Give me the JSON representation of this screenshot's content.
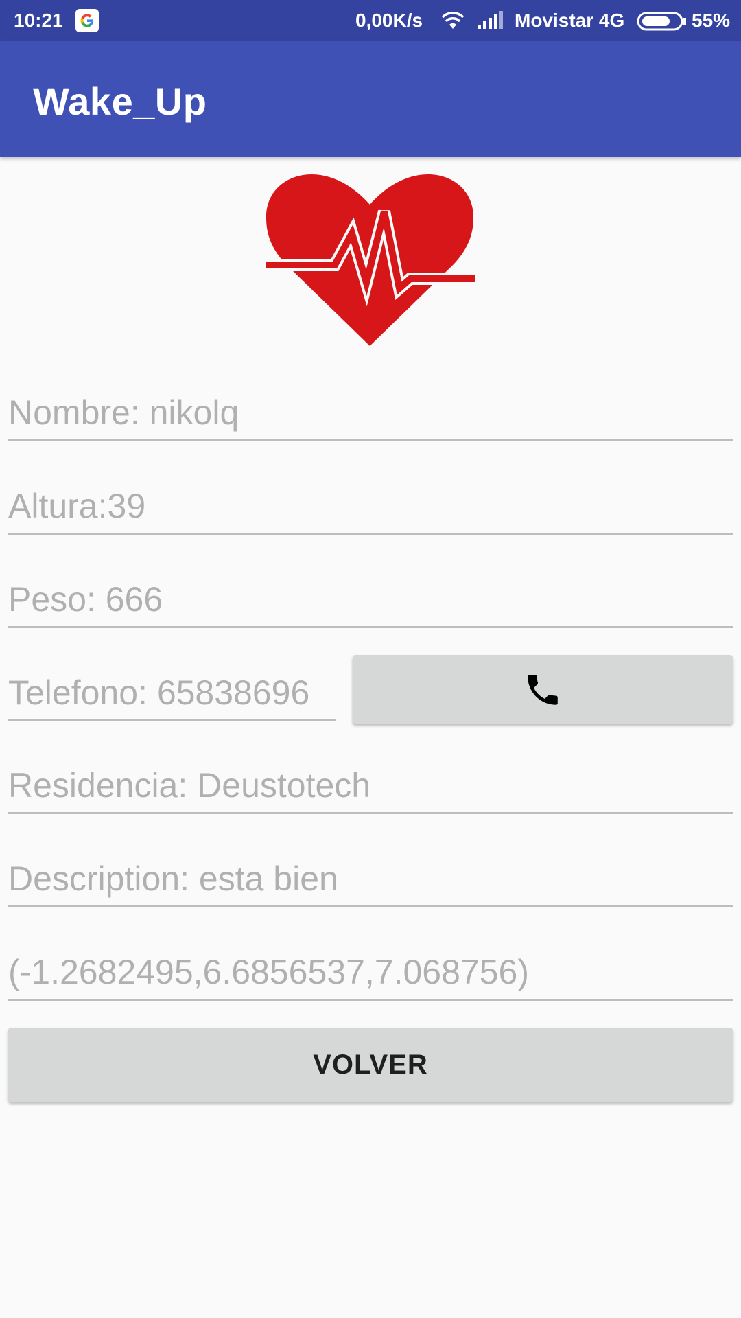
{
  "status_bar": {
    "time": "10:21",
    "net_speed": "0,00K/s",
    "carrier": "Movistar 4G",
    "battery": "55%",
    "icons": [
      "google-icon",
      "wifi-icon",
      "signal-icon",
      "battery-icon"
    ]
  },
  "app_bar": {
    "title": "Wake_Up",
    "color": "#3f51b5"
  },
  "logo": {
    "icon": "heart-pulse-icon",
    "color": "#d7161a"
  },
  "fields": {
    "nombre": "Nombre: nikolq",
    "altura": "Altura:39",
    "peso": "Peso: 666",
    "telefono": "Telefono: 65838696",
    "residencia": "Residencia: Deustotech",
    "description": "Description: esta bien",
    "coordinates": "(-1.2682495,6.6856537,7.068756)"
  },
  "call_button": {
    "icon": "phone-icon"
  },
  "volver_button": {
    "label": "VOLVER"
  }
}
